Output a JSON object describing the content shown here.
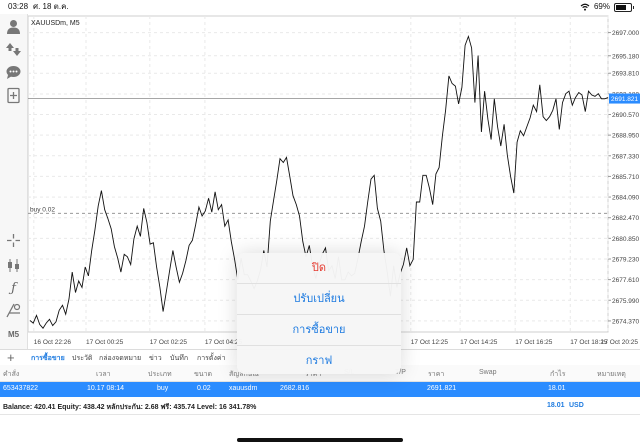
{
  "status": {
    "time": "03:28",
    "date": "ศ. 18 ต.ค.",
    "battery": "69%",
    "battery_level": 0.69
  },
  "chart": {
    "symbol_label": "XAUUSDm, M5",
    "buy_label": "buy 0.02",
    "current_price": "2691.821",
    "price_ticks": [
      "2697.000",
      "2695.180",
      "2693.810",
      "2692.180",
      "2690.570",
      "2688.950",
      "2687.330",
      "2685.710",
      "2684.090",
      "2682.470",
      "2680.850",
      "2679.230",
      "2677.610",
      "2675.990",
      "2674.370"
    ],
    "time_ticks": [
      "16 Oct 22:26",
      "17 Oct 00:25",
      "17 Oct 02:25",
      "17 Oct 04:25",
      "17 Oct 12:25",
      "17 Oct 14:25",
      "17 Oct 16:25",
      "17 Oct 18:25",
      "17 Oct 20:25"
    ]
  },
  "chart_data": {
    "type": "line",
    "title": "XAUUSDm, M5",
    "ylim": [
      2673.5,
      2698.3
    ],
    "current_price": 2691.821,
    "buy_level": 2682.816,
    "y": [
      2674.4,
      2674.2,
      2674.8,
      2674.1,
      2673.8,
      2674.2,
      2674.5,
      2674.0,
      2674.3,
      2675.2,
      2675.6,
      2674.9,
      2676.1,
      2678.2,
      2676.6,
      2677.5,
      2677.0,
      2678.6,
      2677.9,
      2679.9,
      2681.5,
      2683.4,
      2684.6,
      2683.1,
      2682.4,
      2681.6,
      2680.2,
      2679.3,
      2678.2,
      2679.6,
      2679.4,
      2678.8,
      2680.8,
      2681.8,
      2681.0,
      2683.2,
      2682.1,
      2680.4,
      2680.5,
      2678.6,
      2677.0,
      2675.1,
      2676.7,
      2678.3,
      2679.9,
      2678.6,
      2677.4,
      2678.1,
      2679.1,
      2680.3,
      2680.7,
      2681.9,
      2683.3,
      2682.6,
      2683.0,
      2684.0,
      2682.9,
      2684.5,
      2683.1,
      2683.5,
      2681.8,
      2682.3,
      2680.6,
      2679.2,
      2677.6,
      2679.3,
      2678.0,
      2678.0,
      2677.5,
      2676.9,
      2677.5,
      2678.4,
      2679.9,
      2678.6,
      2682.2,
      2683.8,
      2685.4,
      2687.1,
      2686.8,
      2687.2,
      2685.7,
      2684.2,
      2683.5,
      2682.6,
      2680.6,
      2679.4,
      2680.3,
      2678.7,
      2677.7,
      2678.8,
      2679.6,
      2680.1,
      2678.3,
      2678.7,
      2677.7,
      2679.4,
      2677.6,
      2677.6,
      2678.2,
      2677.9,
      2678.1,
      2679.3,
      2680.6,
      2681.8,
      2683.7,
      2685.5,
      2685.8,
      2683.2,
      2682.2,
      2679.9,
      2678.2,
      2676.3,
      2678.7,
      2677.0,
      2678.1,
      2678.8,
      2680.1,
      2678.7,
      2679.2,
      2683.7,
      2683.7,
      2685.8,
      2685.8,
      2684.8,
      2683.5,
      2685.9,
      2686.4,
      2688.9,
      2690.9,
      2693.6,
      2693.0,
      2692.8,
      2691.4,
      2692.7,
      2696.0,
      2696.7,
      2695.8,
      2691.5,
      2695.2,
      2689.2,
      2692.4,
      2690.2,
      2688.6,
      2691.8,
      2689.6,
      2688.1,
      2689.8,
      2687.4,
      2685.7,
      2684.4,
      2688.4,
      2689.3,
      2688.9,
      2689.6,
      2690.3,
      2691.3,
      2690.8,
      2692.9,
      2690.4,
      2690.1,
      2690.4,
      2690.9,
      2691.8,
      2689.4,
      2691.5,
      2692.2,
      2692.4,
      2691.3,
      2691.9,
      2692.3,
      2692.1,
      2690.8,
      2692.4,
      2692.1,
      2692.0,
      2692.2,
      2691.8,
      2691.8,
      2691.9
    ]
  },
  "toolbar": {
    "icons": [
      "person-icon",
      "trade-arrows-icon",
      "chat-icon",
      "new-order-icon",
      "crosshair-icon",
      "candlestick-icon",
      "function-icon",
      "objects-icon",
      "timeframe-icon"
    ],
    "timeframe": "M5"
  },
  "tabs": [
    "การซื้อขาย",
    "ประวัติ",
    "กล่องจดหมาย",
    "ข่าว",
    "บันทึก",
    "การตั้งค่า"
  ],
  "table": {
    "headers": [
      "คำสั่ง",
      "เวลา",
      "ประเภท",
      "ขนาด",
      "สัญลักษณ์",
      "ราคา",
      "S/L",
      "T/P",
      "ราคา",
      "Swap",
      "กำไร",
      "หมายเหตุ"
    ],
    "row": [
      "653437822",
      "10.17 08:14",
      "buy",
      "0.02",
      "xauusdm",
      "2682.816",
      "",
      "",
      "2691.821",
      "",
      "18.01",
      ""
    ]
  },
  "balance": {
    "text": "Balance: 420.41  Equity: 438.42  หลักประกัน: 2.68  ฟรี: 435.74  Level: 16 341.78%",
    "profit": "18.01",
    "currency": "USD"
  },
  "popup": {
    "items": [
      "ปิด",
      "ปรับเปลี่ยน",
      "การซื้อขาย",
      "กราฟ"
    ]
  }
}
